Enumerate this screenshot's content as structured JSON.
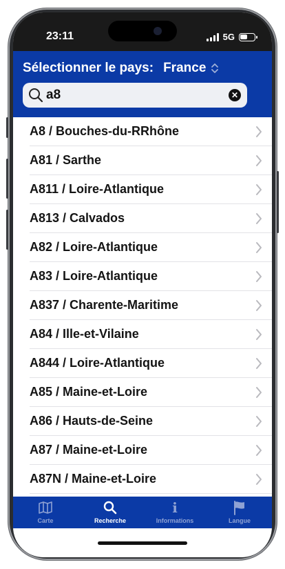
{
  "status_bar": {
    "time": "23:11",
    "network": "5G"
  },
  "header": {
    "country_label": "Sélectionner le pays:",
    "country_value": "France",
    "search_value": "a8",
    "accent_color": "#0b3aa6"
  },
  "results": [
    {
      "label": "A8 / Bouches-du-RRhône"
    },
    {
      "label": "A81 / Sarthe"
    },
    {
      "label": "A811 / Loire-Atlantique"
    },
    {
      "label": "A813 / Calvados"
    },
    {
      "label": "A82 / Loire-Atlantique"
    },
    {
      "label": "A83 / Loire-Atlantique"
    },
    {
      "label": "A837 / Charente-Maritime"
    },
    {
      "label": "A84 / Ille-et-Vilaine"
    },
    {
      "label": "A844 / Loire-Atlantique"
    },
    {
      "label": "A85 / Maine-et-Loire"
    },
    {
      "label": "A86 / Hauts-de-Seine"
    },
    {
      "label": "A87 / Maine-et-Loire"
    },
    {
      "label": "A87N / Maine-et-Loire"
    }
  ],
  "tabs": [
    {
      "label": "Carte",
      "icon": "map-icon",
      "active": false
    },
    {
      "label": "Recherche",
      "icon": "search-icon",
      "active": true
    },
    {
      "label": "Informations",
      "icon": "info-icon",
      "active": false
    },
    {
      "label": "Langue",
      "icon": "flag-icon",
      "active": false
    }
  ]
}
